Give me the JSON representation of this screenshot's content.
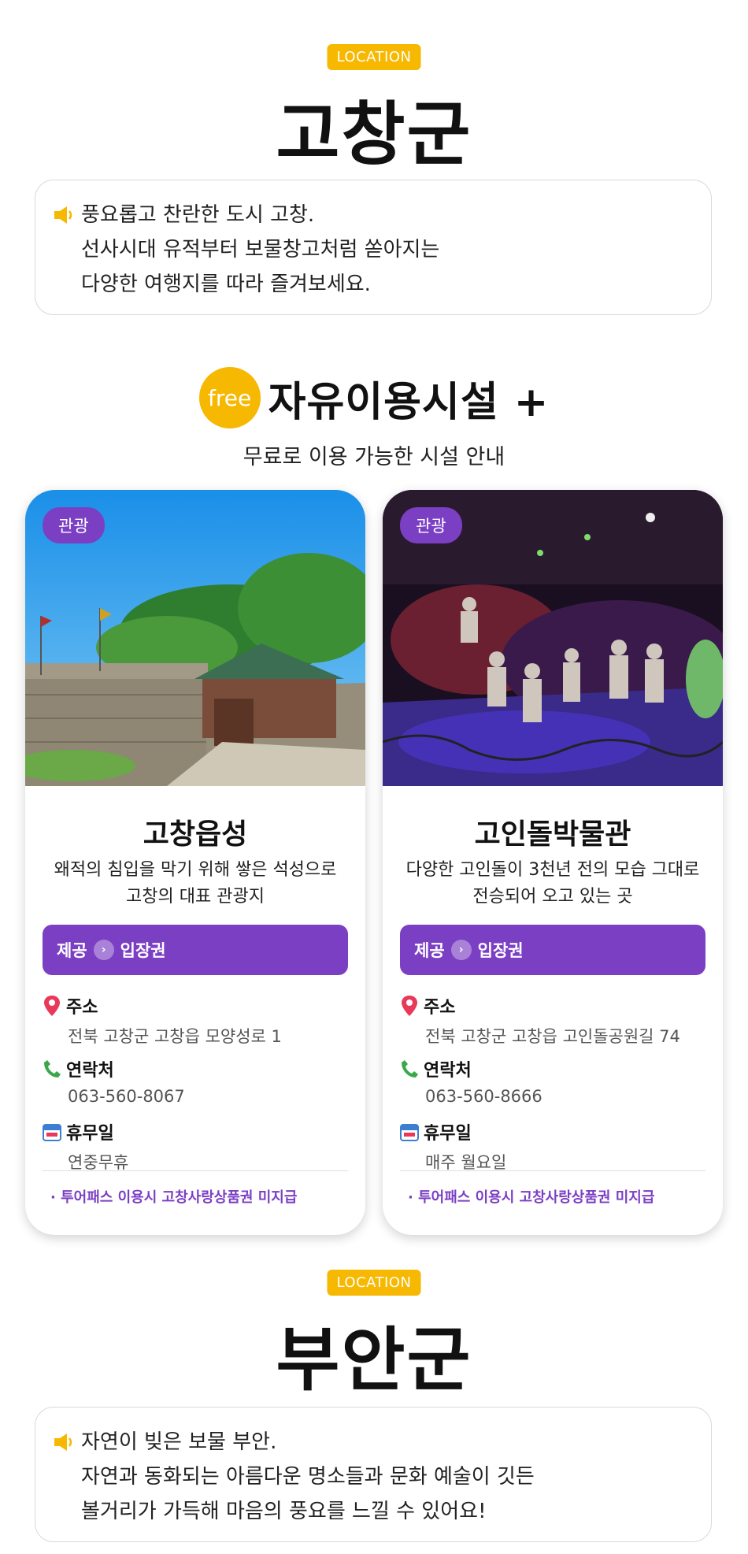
{
  "sections": [
    {
      "location_badge": "LOCATION",
      "region": "고창군",
      "intro_lines": [
        "풍요롭고 찬란한 도시 고창.",
        "선사시대 유적부터 보물창고처럼 쏟아지는",
        "다양한 여행지를 따라 즐겨보세요."
      ]
    },
    {
      "location_badge": "LOCATION",
      "region": "부안군",
      "intro_lines": [
        "자연이 빚은 보물 부안.",
        "자연과 동화되는 아름다운 명소들과 문화 예술이 깃든",
        "볼거리가 가득해 마음의 풍요를 느낄 수 있어요!"
      ]
    }
  ],
  "free_section": {
    "badge": "free",
    "title": "자유이용시설 +",
    "subtitle": "무료로 이용 가능한 시설 안내"
  },
  "cards": [
    {
      "category": "관광",
      "photo_icon": "fortress-wall-photo",
      "name": "고창읍성",
      "desc_lines": [
        "왜적의 침입을 막기 위해 쌓은 석성으로",
        "고창의 대표 관광지"
      ],
      "offer_label": "제공",
      "offer_value": "입장권",
      "address_label": "주소",
      "address": "전북 고창군 고창읍 모양성로 1",
      "contact_label": "연락처",
      "contact": "063-560-8067",
      "closed_label": "휴무일",
      "closed": "연중무휴",
      "note": "· 투어패스 이용시 고창사랑상품권 미지급"
    },
    {
      "category": "관광",
      "photo_icon": "museum-diorama-photo",
      "name": "고인돌박물관",
      "desc_lines": [
        "다양한 고인돌이 3천년 전의 모습 그대로",
        "전승되어 오고 있는 곳"
      ],
      "offer_label": "제공",
      "offer_value": "입장권",
      "address_label": "주소",
      "address": "전북 고창군 고창읍 고인돌공원길 74",
      "contact_label": "연락처",
      "contact": "063-560-8666",
      "closed_label": "휴무일",
      "closed": "매주 월요일",
      "note": "· 투어패스 이용시 고창사랑상품권 미지급"
    }
  ],
  "colors": {
    "yellow": "#f6b800",
    "purple": "#7b3fc4",
    "pin": "#e8395a",
    "phone": "#3aa84a"
  }
}
